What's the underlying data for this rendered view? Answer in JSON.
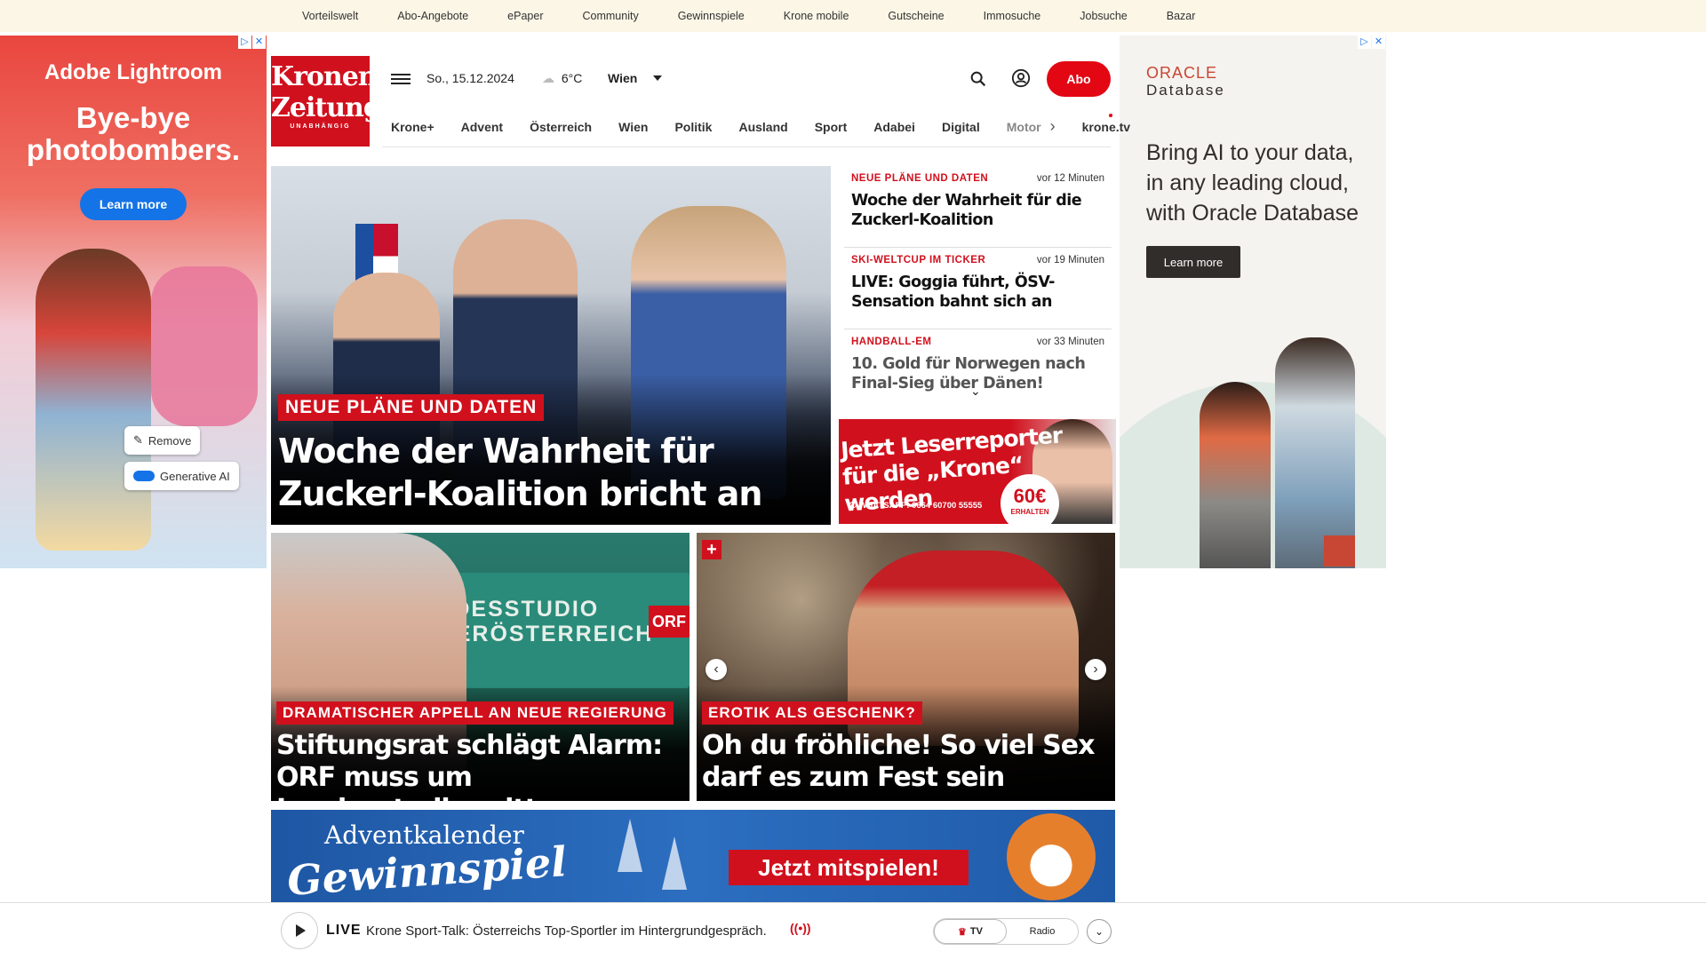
{
  "topbar": {
    "links": [
      "Vorteilswelt",
      "Abo-Angebote",
      "ePaper",
      "Community",
      "Gewinnspiele",
      "Krone mobile",
      "Gutscheine",
      "Immosuche",
      "Jobsuche",
      "Bazar"
    ]
  },
  "ad_left": {
    "brand": "Adobe Lightroom",
    "headline": "Bye-bye photobombers.",
    "cta": "Learn more",
    "remove_label": "Remove",
    "genai_label": "Generative AI",
    "icon": "adchoices-icon"
  },
  "ad_right": {
    "logo_line1": "ORACLE",
    "logo_line2": "Database",
    "text": "Bring AI to your data, in any leading cloud, with Oracle Database",
    "cta": "Learn more"
  },
  "header": {
    "masthead_line1": "Kronen",
    "masthead_line2": "Zeitung",
    "masthead_tagline": "UNABHÄNGIG",
    "date": "So., 15.12.2024",
    "weather": "6°C",
    "city": "Wien",
    "abo": "Abo",
    "brand_color": "#d1101d"
  },
  "nav": {
    "items": [
      "Krone+",
      "Advent",
      "Österreich",
      "Wien",
      "Politik",
      "Ausland",
      "Sport",
      "Adabei",
      "Digital"
    ],
    "faded_item": "Motor",
    "external": "krone.tv"
  },
  "hero": {
    "kicker": "NEUE PLÄNE UND DATEN",
    "title": "Woche der Wahrheit für Zuckerl-Koalition bricht an"
  },
  "ticker": [
    {
      "category": "NEUE PLÄNE UND DATEN",
      "time": "vor 12 Minuten",
      "title": "Woche der Wahrheit für die Zuckerl-Koalition"
    },
    {
      "category": "SKI-WELTCUP IM TICKER",
      "time": "vor 19 Minuten",
      "title": "LIVE: Goggia führt, ÖSV-Sensation bahnt sich an"
    },
    {
      "category": "HANDBALL-EM",
      "time": "vor 33 Minuten",
      "title": "10. Gold für Norwegen nach Final-Sieg über Dänen!"
    }
  ],
  "reporter_ad": {
    "line1": "Jetzt Leserreporter",
    "line2": "für die „Krone“ werden",
    "whatsapp": "WHATSAPP: 0664 60700 55555",
    "amount": "60€",
    "amount_sub": "ERHALTEN"
  },
  "card_orf": {
    "sign_line1": "LANDESSTUDIO",
    "sign_line2": "NIEDERÖSTERREICH",
    "orf": "ORF",
    "kicker": "DRAMATISCHER APPELL AN NEUE REGIERUNG",
    "title": "Stiftungsrat schlägt Alarm: ORF muss um Landesstudios zittern"
  },
  "card_erotik": {
    "plus": "+",
    "kicker": "EROTIK ALS GESCHENK?",
    "title": "Oh du fröhliche! So viel Sex darf es zum Fest sein"
  },
  "advent": {
    "line1": "Adventkalender",
    "line2": "Gewinnspiel",
    "cta": "Jetzt mitspielen!"
  },
  "player": {
    "live": "LIVE",
    "text": "Krone Sport-Talk: Österreichs Top-Sportler im Hintergrundgespräch.",
    "tv": "TV",
    "radio": "Radio"
  }
}
